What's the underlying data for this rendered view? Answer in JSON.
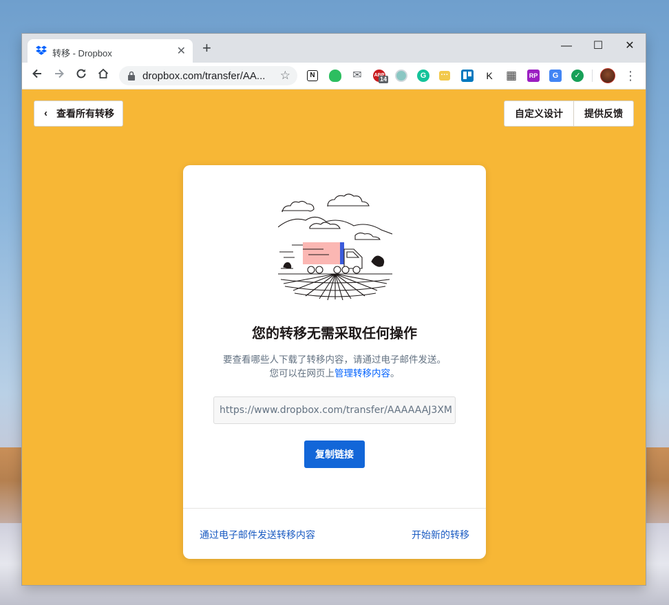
{
  "browser": {
    "tab_title": "转移 - Dropbox",
    "tab_close": "✕",
    "new_tab": "+",
    "window_controls": {
      "minimize": "—",
      "maximize": "☐",
      "close": "✕"
    },
    "url": "dropbox.com/transfer/AA...",
    "extensions": [
      {
        "name": "notion-extension-icon",
        "glyph": "N",
        "color": "#111111"
      },
      {
        "name": "evernote-extension-icon",
        "glyph": "",
        "color": "#2dbe60"
      },
      {
        "name": "mail-extension-icon",
        "glyph": "✉",
        "color": "#5f6368"
      },
      {
        "name": "abp-extension-icon",
        "glyph": "ABP",
        "color": "#c91d20",
        "badge": "14"
      },
      {
        "name": "circle-extension-icon",
        "glyph": "",
        "color": "#8ac7c3"
      },
      {
        "name": "grammarly-extension-icon",
        "glyph": "G",
        "color": "#15c39a"
      },
      {
        "name": "ellipsis-extension-icon",
        "glyph": "···",
        "color": "#f2c94c"
      },
      {
        "name": "trello-extension-icon",
        "glyph": "",
        "color": "#0079bf"
      },
      {
        "name": "k-extension-icon",
        "glyph": "K",
        "color": "#111111"
      },
      {
        "name": "qr-extension-icon",
        "glyph": "▦",
        "color": "#444444"
      },
      {
        "name": "rp-extension-icon",
        "glyph": "RP",
        "color": "#9b1fc2"
      },
      {
        "name": "translate-extension-icon",
        "glyph": "G",
        "color": "#4285f4"
      },
      {
        "name": "shield-extension-icon",
        "glyph": "✓",
        "color": "#18a058"
      }
    ]
  },
  "page": {
    "back_button": "查看所有转移",
    "customize_button": "自定义设计",
    "feedback_button": "提供反馈",
    "card": {
      "title": "您的转移无需采取任何操作",
      "desc_line1": "要查看哪些人下载了转移内容，请通过电子邮件发送。",
      "desc_line2_prefix": "您可以在网页上",
      "desc_line2_link": "管理转移内容",
      "desc_line2_suffix": "。",
      "link_value": "https://www.dropbox.com/transfer/AAAAAAJ3XM",
      "copy_button": "复制链接",
      "email_link": "通过电子邮件发送转移内容",
      "new_transfer_link": "开始新的转移"
    }
  },
  "colors": {
    "page_background": "#f7b736",
    "primary_button": "#1266d8",
    "link": "#1a5bc2"
  }
}
